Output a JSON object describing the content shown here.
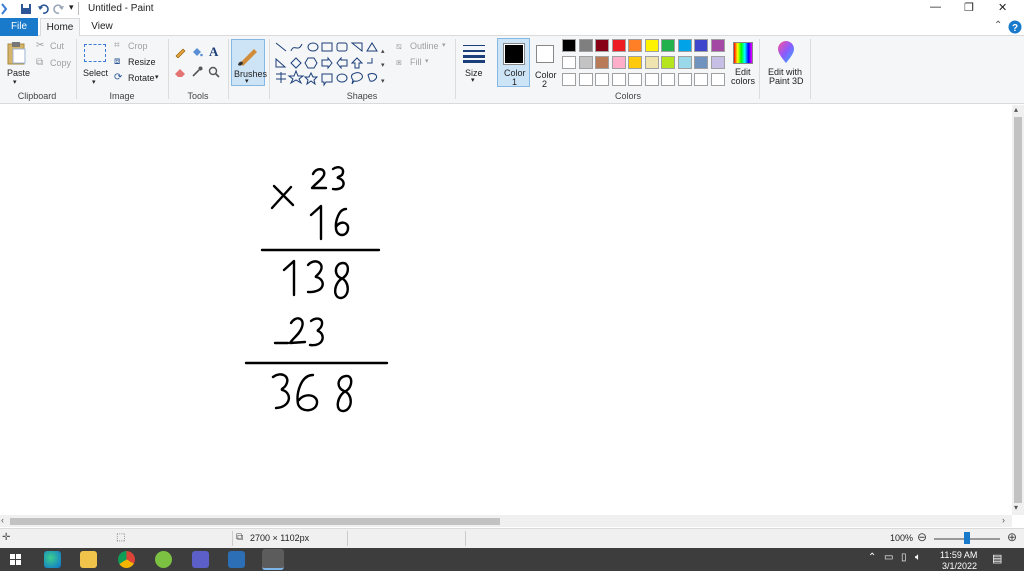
{
  "window": {
    "title": "Untitled - Paint",
    "min_glyph": "—",
    "max_glyph": "❐",
    "close_glyph": "✕"
  },
  "tabs": {
    "file": "File",
    "home": "Home",
    "view": "View"
  },
  "clipboard": {
    "paste": "Paste",
    "cut": "Cut",
    "copy": "Copy",
    "group": "Clipboard"
  },
  "image": {
    "select": "Select",
    "crop": "Crop",
    "resize": "Resize",
    "rotate": "Rotate",
    "group": "Image"
  },
  "tools": {
    "group": "Tools"
  },
  "brushes": {
    "label": "Brushes"
  },
  "shapes": {
    "outline": "Outline",
    "fill": "Fill",
    "group": "Shapes"
  },
  "size": {
    "label": "Size"
  },
  "color1": {
    "label": "Color",
    "num": "1",
    "value": "#000000"
  },
  "color2": {
    "label": "Color",
    "num": "2",
    "value": "#ffffff"
  },
  "colors": {
    "group": "Colors",
    "row1": [
      "#000000",
      "#7f7f7f",
      "#880015",
      "#ed1c24",
      "#ff7f27",
      "#fff200",
      "#22b14c",
      "#00a2e8",
      "#3f48cc",
      "#a349a4"
    ],
    "row2": [
      "#ffffff",
      "#c3c3c3",
      "#b97a57",
      "#ffaec9",
      "#ffc90e",
      "#efe4b0",
      "#b5e61d",
      "#99d9ea",
      "#7092be",
      "#c8bfe7"
    ],
    "row3": [
      "#ffffff",
      "#ffffff",
      "#ffffff",
      "#ffffff",
      "#ffffff",
      "#ffffff",
      "#ffffff",
      "#ffffff",
      "#ffffff",
      "#ffffff"
    ]
  },
  "edit_colors": {
    "line1": "Edit",
    "line2": "colors"
  },
  "paint3d": {
    "line1": "Edit with",
    "line2": "Paint 3D"
  },
  "status": {
    "dimensions": "2700 × 1102px",
    "zoom": "100%",
    "zoom_level": 0.5
  },
  "taskbar": {
    "time": "11:59 AM",
    "date": "3/1/2022"
  }
}
